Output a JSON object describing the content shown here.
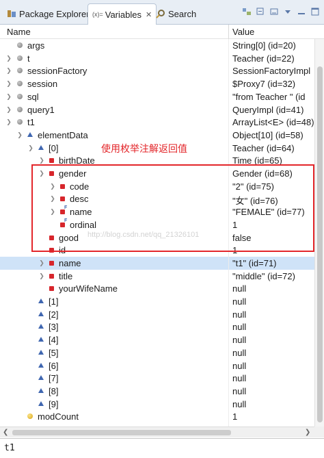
{
  "tabs": [
    {
      "label": "Package Explorer",
      "icon": "package-explorer-icon"
    },
    {
      "label": "Variables",
      "icon": "variables-icon",
      "prefix": "(x)=",
      "active": true
    },
    {
      "label": "Search",
      "icon": "search-icon"
    }
  ],
  "columns": {
    "name": "Name",
    "value": "Value"
  },
  "annotation": "使用枚举注解返回值",
  "watermark": "http://blog.csdn.net/qq_21326101",
  "rows": [
    {
      "name": "args",
      "value": "String[0]  (id=20)"
    },
    {
      "name": "t",
      "value": "Teacher  (id=22)"
    },
    {
      "name": "sessionFactory",
      "value": "SessionFactoryImpl"
    },
    {
      "name": "session",
      "value": "$Proxy7  (id=32)"
    },
    {
      "name": "sql",
      "value": "\"from Teacher \" (id"
    },
    {
      "name": "query1",
      "value": "QueryImpl  (id=41)"
    },
    {
      "name": "t1",
      "value": "ArrayList<E>  (id=48)"
    },
    {
      "name": "elementData",
      "value": "Object[10]  (id=58)"
    },
    {
      "name": "[0]",
      "value": "Teacher  (id=64)"
    },
    {
      "name": "birthDate",
      "value": "Time  (id=65)"
    },
    {
      "name": "gender",
      "value": "Gender  (id=68)"
    },
    {
      "name": "code",
      "value": "\"2\" (id=75)"
    },
    {
      "name": "desc",
      "value": "\"女\" (id=76)"
    },
    {
      "name": "name",
      "value": "\"FEMALE\" (id=77)"
    },
    {
      "name": "ordinal",
      "value": "1"
    },
    {
      "name": "good",
      "value": "false"
    },
    {
      "name": "id",
      "value": "1"
    },
    {
      "name": "name",
      "value": "\"t1\" (id=71)"
    },
    {
      "name": "title",
      "value": "\"middle\" (id=72)"
    },
    {
      "name": "yourWifeName",
      "value": "null"
    },
    {
      "name": "[1]",
      "value": "null"
    },
    {
      "name": "[2]",
      "value": "null"
    },
    {
      "name": "[3]",
      "value": "null"
    },
    {
      "name": "[4]",
      "value": "null"
    },
    {
      "name": "[5]",
      "value": "null"
    },
    {
      "name": "[6]",
      "value": "null"
    },
    {
      "name": "[7]",
      "value": "null"
    },
    {
      "name": "[8]",
      "value": "null"
    },
    {
      "name": "[9]",
      "value": "null"
    },
    {
      "name": "modCount",
      "value": "1"
    },
    {
      "name": "",
      "value": "1"
    }
  ],
  "detail_text": "t1",
  "colors": {
    "annotation": "#e3262a",
    "selection": "#cfe3f8",
    "field_private": "#d7262c",
    "array_element": "#3f66b0"
  }
}
